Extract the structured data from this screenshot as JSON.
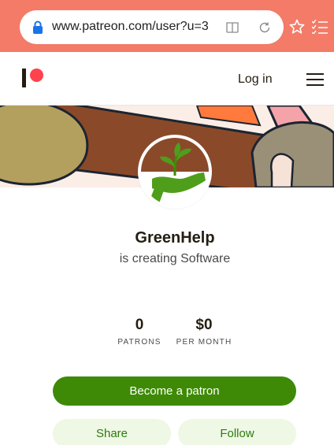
{
  "browser": {
    "url": "www.patreon.com/user?u=3",
    "icons": [
      "lock-icon",
      "reader-icon",
      "reload-icon",
      "star-icon",
      "list-icon"
    ],
    "bar_color": "#f37b68"
  },
  "header": {
    "login_label": "Log in",
    "logo_color": "#ff424d"
  },
  "creator": {
    "name": "GreenHelp",
    "subtitle": "is creating Software"
  },
  "stats": {
    "patrons_value": "0",
    "patrons_label": "PATRONS",
    "month_value": "$0",
    "month_label": "PER MONTH"
  },
  "actions": {
    "become_patron_label": "Become a patron",
    "share_label": "Share",
    "follow_label": "Follow",
    "primary_color": "#3e8a06"
  }
}
